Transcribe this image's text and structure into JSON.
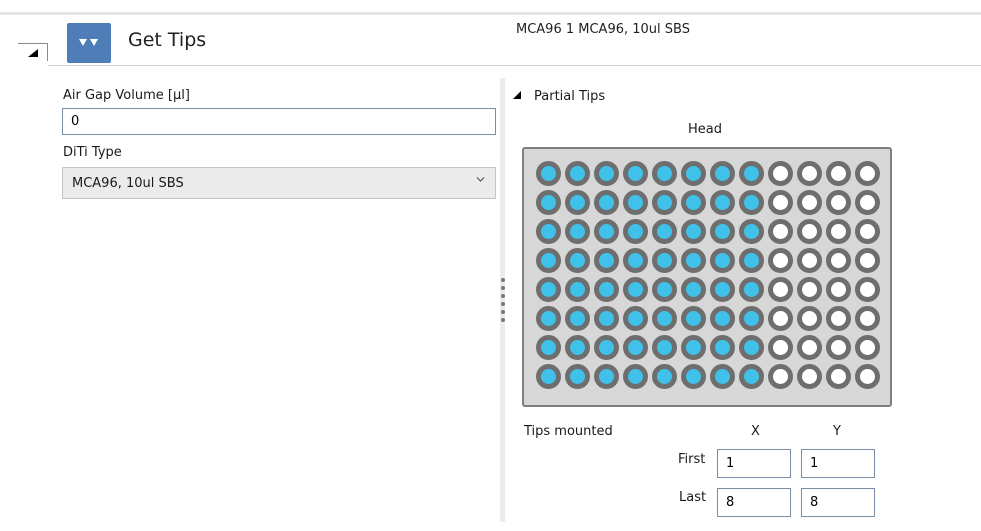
{
  "command": {
    "title": "Get Tips",
    "summary": "MCA96 1 MCA96, 10ul SBS",
    "icon": "double-down-arrow-icon",
    "icon_bg": "#4f7db8"
  },
  "fields": {
    "air_gap_label": "Air Gap Volume [µl]",
    "air_gap_value": "0",
    "diti_label": "DiTi Type",
    "diti_value": "MCA96, 10ul SBS"
  },
  "partial_tips": {
    "section_title": "Partial Tips",
    "head_label": "Head",
    "columns": 12,
    "rows": 8,
    "mounted_color": "#3fc1ea",
    "empty_color": "#ffffff",
    "rim_color": "#6e6e6e",
    "tips_mounted_label": "Tips mounted",
    "x_label": "X",
    "y_label": "Y",
    "first_label": "First",
    "last_label": "Last",
    "first_x": "1",
    "first_y": "1",
    "last_x": "8",
    "last_y": "8"
  }
}
